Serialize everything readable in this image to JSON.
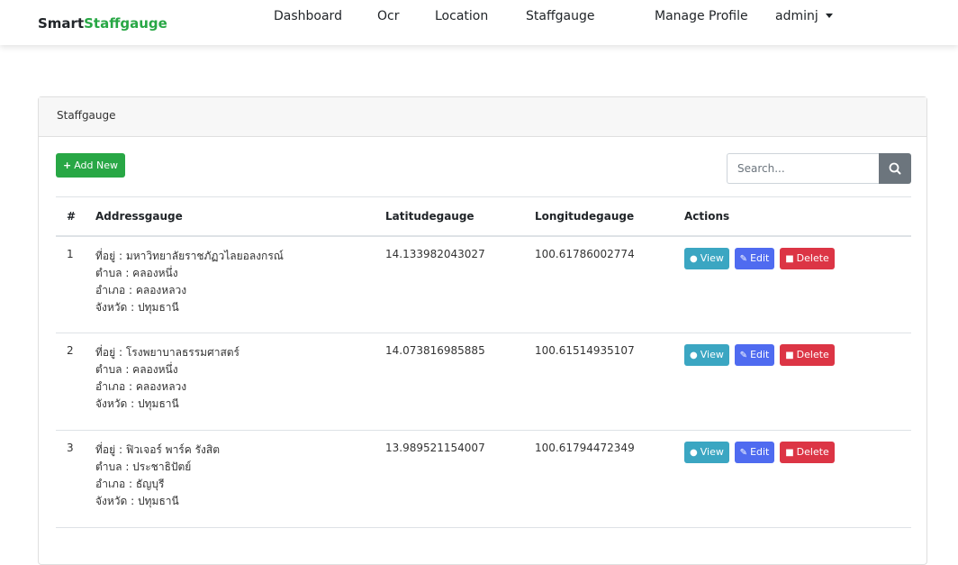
{
  "brand": {
    "part1": "Smart",
    "part2": "Staffgauge"
  },
  "nav": {
    "dashboard": "Dashboard",
    "ocr": "Ocr",
    "location": "Location",
    "staffgauge": "Staffgauge",
    "manage_profile": "Manage Profile",
    "user": "adminj"
  },
  "card": {
    "title": "Staffgauge"
  },
  "toolbar": {
    "add_label": "Add New",
    "search_placeholder": "Search..."
  },
  "table": {
    "headers": [
      "#",
      "Addressgauge",
      "Latitudegauge",
      "Longitudegauge",
      "Actions"
    ],
    "action_labels": {
      "view": "View",
      "edit": "Edit",
      "delete": "Delete"
    },
    "rows": [
      {
        "num": "1",
        "address": [
          "ที่อยู่ : มหาวิทยาลัยราชภัฏวไลยอลงกรณ์",
          "ตำบล : คลองหนึ่ง",
          "อำเภอ : คลองหลวง",
          "จังหวัด : ปทุมธานี"
        ],
        "lat": "14.133982043027",
        "lng": "100.61786002774"
      },
      {
        "num": "2",
        "address": [
          "ที่อยู่ : โรงพยาบาลธรรมศาสตร์",
          "ตำบล : คลองหนึ่ง",
          "อำเภอ : คลองหลวง",
          "จังหวัด : ปทุมธานี"
        ],
        "lat": "14.073816985885",
        "lng": "100.61514935107"
      },
      {
        "num": "3",
        "address": [
          "ที่อยู่ : ฟิวเจอร์ พาร์ค รังสิต",
          "ตำบล : ประชาธิปัตย์",
          "อำเภอ : ธัญบุรี",
          "จังหวัด : ปทุมธานี"
        ],
        "lat": "13.989521154007",
        "lng": "100.61794472349"
      }
    ]
  }
}
